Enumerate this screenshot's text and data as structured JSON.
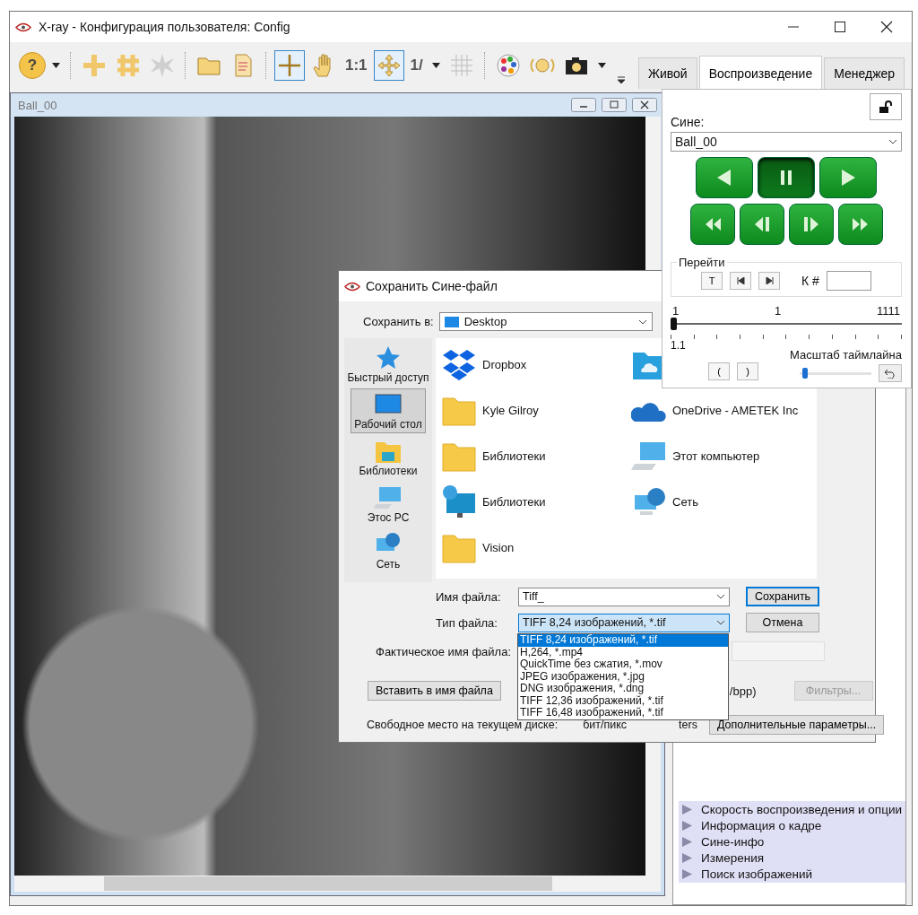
{
  "window": {
    "title": "X-ray - Конфигурация пользователя: Config"
  },
  "toolbar": [
    {
      "kind": "help",
      "label": "?",
      "selected": false
    },
    {
      "kind": "caret"
    },
    {
      "kind": "sep"
    },
    {
      "kind": "cross",
      "selected": false
    },
    {
      "kind": "hash",
      "selected": false
    },
    {
      "kind": "burst",
      "selected": false
    },
    {
      "kind": "sep"
    },
    {
      "kind": "folder",
      "selected": false
    },
    {
      "kind": "doc",
      "selected": false
    },
    {
      "kind": "sep"
    },
    {
      "kind": "crosshair",
      "selected": true
    },
    {
      "kind": "hand",
      "selected": false
    },
    {
      "kind": "text",
      "label": "1:1",
      "selected": false
    },
    {
      "kind": "move",
      "selected": true
    },
    {
      "kind": "text",
      "label": "1/",
      "selected": false
    },
    {
      "kind": "caret"
    },
    {
      "kind": "grid",
      "selected": false
    },
    {
      "kind": "sep"
    },
    {
      "kind": "palette",
      "selected": false
    },
    {
      "kind": "sound",
      "selected": false
    },
    {
      "kind": "camera",
      "selected": false
    },
    {
      "kind": "caret"
    }
  ],
  "tabs": [
    {
      "label": "Живой",
      "selected": false
    },
    {
      "label": "Воспроизведение",
      "selected": true
    },
    {
      "label": "Менеджер",
      "selected": false
    }
  ],
  "image_window": {
    "title": "Ball_00"
  },
  "playback": {
    "cine_label": "Сине:",
    "cine_value": "Ball_00",
    "buttons": [
      {
        "kind": "reverse",
        "pressed": false
      },
      {
        "kind": "pause",
        "pressed": true
      },
      {
        "kind": "play",
        "pressed": false
      },
      {
        "kind": "fast_rewind",
        "pressed": false
      },
      {
        "kind": "step_back",
        "pressed": false
      },
      {
        "kind": "step_forward",
        "pressed": false
      },
      {
        "kind": "fast_forward",
        "pressed": false
      }
    ],
    "goto": {
      "title": "Перейти",
      "t_button": "T",
      "frame_label": "К #"
    },
    "timeline": {
      "start": "1",
      "current": "1",
      "end": "1111",
      "level": 0,
      "sub_label": "1.1"
    },
    "zoom": {
      "title": "Масштаб таймлайна",
      "open_bracket": "(",
      "close_bracket": ")",
      "level": 0.04
    }
  },
  "sections": [
    {
      "label": "Скорость воспроизведения и опции"
    },
    {
      "label": "Информация о кадре"
    },
    {
      "label": "Сине-инфо"
    },
    {
      "label": "Измерения"
    },
    {
      "label": "Поиск изображений"
    }
  ],
  "dialog": {
    "title": "Сохранить Сине-файл",
    "save_in_label": "Сохранить в:",
    "save_in_value": "Desktop",
    "places": [
      {
        "kind": "star",
        "label": "Быстрый доступ",
        "selected": false
      },
      {
        "kind": "desktop",
        "label": "Рабочий стол",
        "selected": true
      },
      {
        "kind": "libraries",
        "label": "Библиотеки",
        "selected": false
      },
      {
        "kind": "pc",
        "label": "Этос PC",
        "selected": false
      },
      {
        "kind": "network",
        "label": "Сеть",
        "selected": false
      }
    ],
    "files": [
      {
        "kind": "dropbox",
        "label": "Dropbox"
      },
      {
        "kind": "cloud_folder"
      },
      {
        "kind": "folder",
        "label": "Kyle Gilroy"
      },
      {
        "kind": "onedrive",
        "label": "OneDrive - AMETEK Inc"
      },
      {
        "kind": "folder",
        "label": "Библиотеки"
      },
      {
        "kind": "pc",
        "label": "Этот компьютер"
      },
      {
        "kind": "globe_monitor",
        "label": "Библиотеки"
      },
      {
        "kind": "network",
        "label": "Сеть"
      },
      {
        "kind": "folder",
        "label": "Vision"
      }
    ],
    "filename_label": "Имя файла:",
    "filename_value": "Tiff_",
    "filetype_label": "Тип файла:",
    "filetype_value": "TIFF 8,24 изображений, *.tif",
    "save_button": "Сохранить",
    "cancel_button": "Отмена",
    "actual_name_label": "Фактическое имя файла:",
    "insert_button": "Вставить в имя файла",
    "bpp_fragment": "/bpp)",
    "filters_button": "Фильтры...",
    "free_space_label": "Свободное место на текущем диске:",
    "bits_fragment": "бит/пикс",
    "ters_fragment": "ters",
    "advanced_button": "Дополнительные параметры...",
    "filetype_options": [
      {
        "label": "TIFF 8,24 изображений, *.tif",
        "selected": true
      },
      {
        "label": "H,264, *.mp4",
        "selected": false
      },
      {
        "label": "QuickTime без сжатия, *.mov",
        "selected": false
      },
      {
        "label": "JPEG изображения, *.jpg",
        "selected": false
      },
      {
        "label": "DNG изображения, *.dng",
        "selected": false
      },
      {
        "label": "TIFF 12,36 изображений, *.tif",
        "selected": false
      },
      {
        "label": "TIFF 16,48 изображений, *.tif",
        "selected": false
      }
    ]
  }
}
